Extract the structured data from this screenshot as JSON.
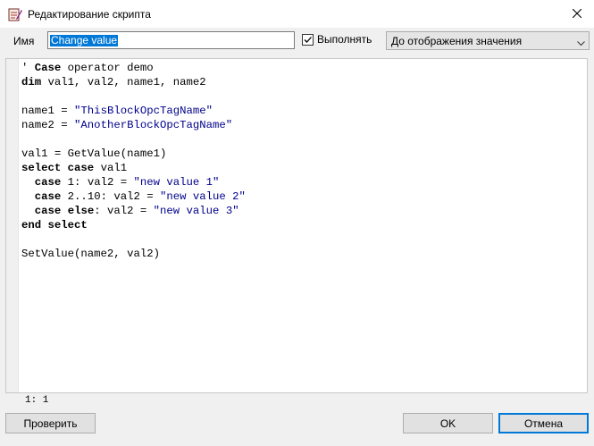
{
  "window": {
    "title": "Редактирование скрипта",
    "icon": "script-edit-icon",
    "close_icon": "close-icon"
  },
  "toolbar": {
    "name_label": "Имя",
    "name_value": "Change value",
    "execute_label": "Выполнять",
    "execute_checked": true,
    "mode_value": "До отображения значения"
  },
  "editor": {
    "lines": [
      [
        {
          "t": "' ",
          "c": "plain"
        },
        {
          "t": "Case",
          "c": "kw"
        },
        {
          "t": " operator demo",
          "c": "plain"
        }
      ],
      [
        {
          "t": "dim",
          "c": "kw"
        },
        {
          "t": " val1, val2, name1, name2",
          "c": "plain"
        }
      ],
      [],
      [
        {
          "t": "name1 = ",
          "c": "plain"
        },
        {
          "t": "\"ThisBlockOpcTagName\"",
          "c": "str"
        }
      ],
      [
        {
          "t": "name2 = ",
          "c": "plain"
        },
        {
          "t": "\"AnotherBlockOpcTagName\"",
          "c": "str"
        }
      ],
      [],
      [
        {
          "t": "val1 = GetValue(name1)",
          "c": "plain"
        }
      ],
      [
        {
          "t": "select",
          "c": "kw"
        },
        {
          "t": " ",
          "c": "plain"
        },
        {
          "t": "case",
          "c": "kw"
        },
        {
          "t": " val1",
          "c": "plain"
        }
      ],
      [
        {
          "t": "  ",
          "c": "plain"
        },
        {
          "t": "case",
          "c": "kw"
        },
        {
          "t": " 1: val2 = ",
          "c": "plain"
        },
        {
          "t": "\"new value 1\"",
          "c": "str"
        }
      ],
      [
        {
          "t": "  ",
          "c": "plain"
        },
        {
          "t": "case",
          "c": "kw"
        },
        {
          "t": " 2..10: val2 = ",
          "c": "plain"
        },
        {
          "t": "\"new value 2\"",
          "c": "str"
        }
      ],
      [
        {
          "t": "  ",
          "c": "plain"
        },
        {
          "t": "case",
          "c": "kw"
        },
        {
          "t": " ",
          "c": "plain"
        },
        {
          "t": "else",
          "c": "kw"
        },
        {
          "t": ": val2 = ",
          "c": "plain"
        },
        {
          "t": "\"new value 3\"",
          "c": "str"
        }
      ],
      [
        {
          "t": "end",
          "c": "kw"
        },
        {
          "t": " ",
          "c": "plain"
        },
        {
          "t": "select",
          "c": "kw"
        }
      ],
      [],
      [
        {
          "t": "SetValue(name2, val2)",
          "c": "plain"
        }
      ]
    ],
    "cursor_position": "1: 1"
  },
  "buttons": {
    "check_label": "Проверить",
    "ok_label": "OK",
    "cancel_label": "Отмена"
  },
  "colors": {
    "selection": "#0078d7",
    "string_literal": "#00008b",
    "default_button_border": "#0078d7"
  }
}
